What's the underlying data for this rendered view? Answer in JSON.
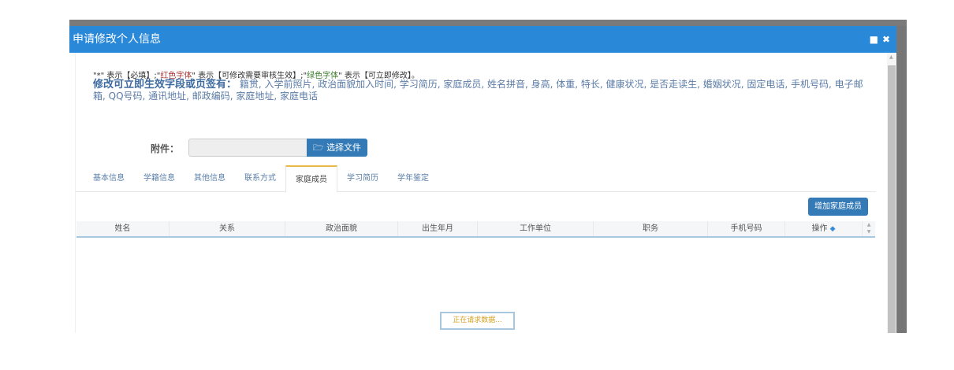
{
  "dialog": {
    "title": "申请修改个人信息",
    "max_icon": "maximize-icon",
    "close_icon": "close-icon"
  },
  "notes": {
    "p1": "\"*\" 表示【必填】;\"",
    "red": "红色字体",
    "p2": "\" 表示【可修改需要审核生效】;\"",
    "green": "绿色字体",
    "p3": "\" 表示【可立即修改】。"
  },
  "fields": {
    "label": "修改可立即生效字段或页签有：",
    "list": "籍贯, 入学前照片, 政治面貌加入时间, 学习简历, 家庭成员, 姓名拼音, 身高, 体重, 特长, 健康状况, 是否走读生, 婚姻状况, 固定电话, 手机号码, 电子邮箱, QQ号码, 通讯地址, 邮政编码, 家庭地址, 家庭电话"
  },
  "attachment": {
    "label": "附件：",
    "value": "",
    "button": "选择文件"
  },
  "tabs": [
    "基本信息",
    "学籍信息",
    "其他信息",
    "联系方式",
    "家庭成员",
    "学习简历",
    "学年鉴定"
  ],
  "active_tab": "家庭成员",
  "add_button": "增加家庭成员",
  "table": {
    "columns": [
      "姓名",
      "关系",
      "政治面貌",
      "出生年月",
      "工作单位",
      "职务",
      "手机号码",
      "操作"
    ]
  },
  "loading": "正在请求数据..."
}
